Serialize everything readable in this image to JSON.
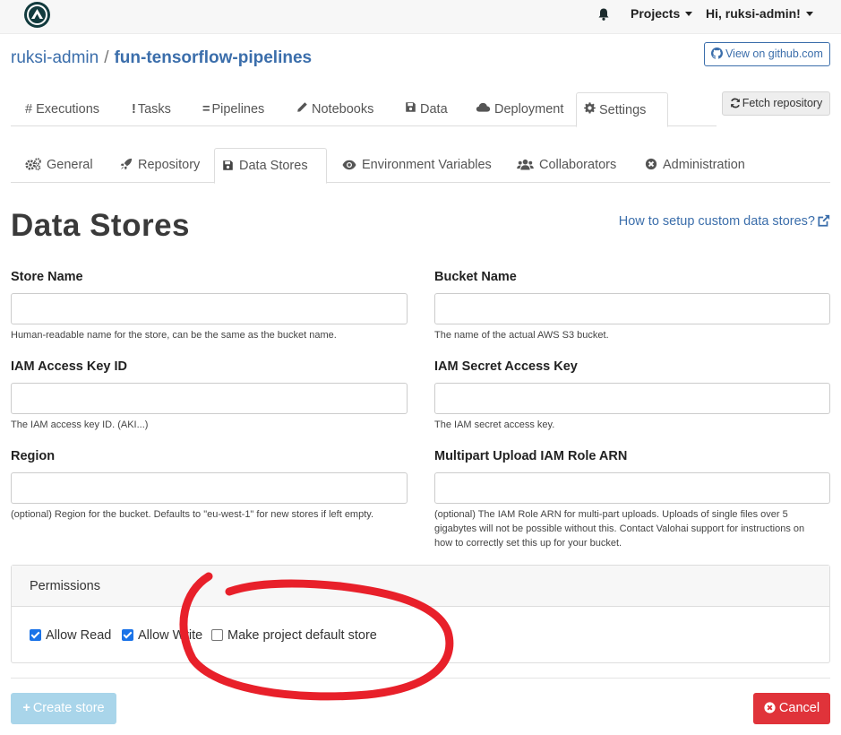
{
  "navbar": {
    "projects_label": "Projects",
    "user_label": "Hi, ruksi-admin!"
  },
  "breadcrumb": {
    "owner": "ruksi-admin",
    "separator": "/",
    "repo": "fun-tensorflow-pipelines"
  },
  "header": {
    "github_button": "View on github.com",
    "fetch_button": "Fetch repository"
  },
  "project_tabs": [
    {
      "label": "Executions",
      "icon": "hash-icon"
    },
    {
      "label": "Tasks",
      "icon": "exclamation-icon"
    },
    {
      "label": "Pipelines",
      "icon": "equals-icon"
    },
    {
      "label": "Notebooks",
      "icon": "pencil-icon"
    },
    {
      "label": "Data",
      "icon": "floppy-icon"
    },
    {
      "label": "Deployment",
      "icon": "cloud-icon"
    },
    {
      "label": "Settings",
      "icon": "gear-icon",
      "active": true
    }
  ],
  "settings_tabs": [
    {
      "label": "General",
      "icon": "cogs-icon"
    },
    {
      "label": "Repository",
      "icon": "rocket-icon"
    },
    {
      "label": "Data Stores",
      "icon": "floppy-icon",
      "active": true
    },
    {
      "label": "Environment Variables",
      "icon": "eye-icon"
    },
    {
      "label": "Collaborators",
      "icon": "users-icon"
    },
    {
      "label": "Administration",
      "icon": "x-circle-icon"
    }
  ],
  "page": {
    "title": "Data Stores",
    "help_link": "How to setup custom data stores?"
  },
  "form": {
    "store_name": {
      "label": "Store Name",
      "value": "",
      "help": "Human-readable name for the store, can be the same as the bucket name."
    },
    "bucket_name": {
      "label": "Bucket Name",
      "value": "",
      "help": "The name of the actual AWS S3 bucket."
    },
    "access_key": {
      "label": "IAM Access Key ID",
      "value": "",
      "help": "The IAM access key ID. (AKI...)"
    },
    "secret_key": {
      "label": "IAM Secret Access Key",
      "value": "",
      "help": "The IAM secret access key."
    },
    "region": {
      "label": "Region",
      "value": "",
      "help": "(optional) Region for the bucket. Defaults to \"eu-west-1\" for new stores if left empty."
    },
    "role_arn": {
      "label": "Multipart Upload IAM Role ARN",
      "value": "",
      "help_lines": [
        "(optional) The IAM Role ARN for multi-part uploads. Uploads of single files over 5",
        "gigabytes will not be possible without this. Contact Valohai support for instructions on",
        "how to correctly set this up for your bucket."
      ]
    }
  },
  "permissions": {
    "title": "Permissions",
    "options": [
      {
        "label": "Allow Read",
        "checked": true
      },
      {
        "label": "Allow Write",
        "checked": true
      },
      {
        "label": "Make project default store",
        "checked": false
      }
    ]
  },
  "actions": {
    "create_label": "Create store",
    "cancel_label": "Cancel"
  },
  "colors": {
    "link": "#3b6eab",
    "primary_disabled": "#a9d5ea",
    "danger": "#e0333a",
    "checkbox": "#1a73e8",
    "annotation": "#e8202a"
  }
}
